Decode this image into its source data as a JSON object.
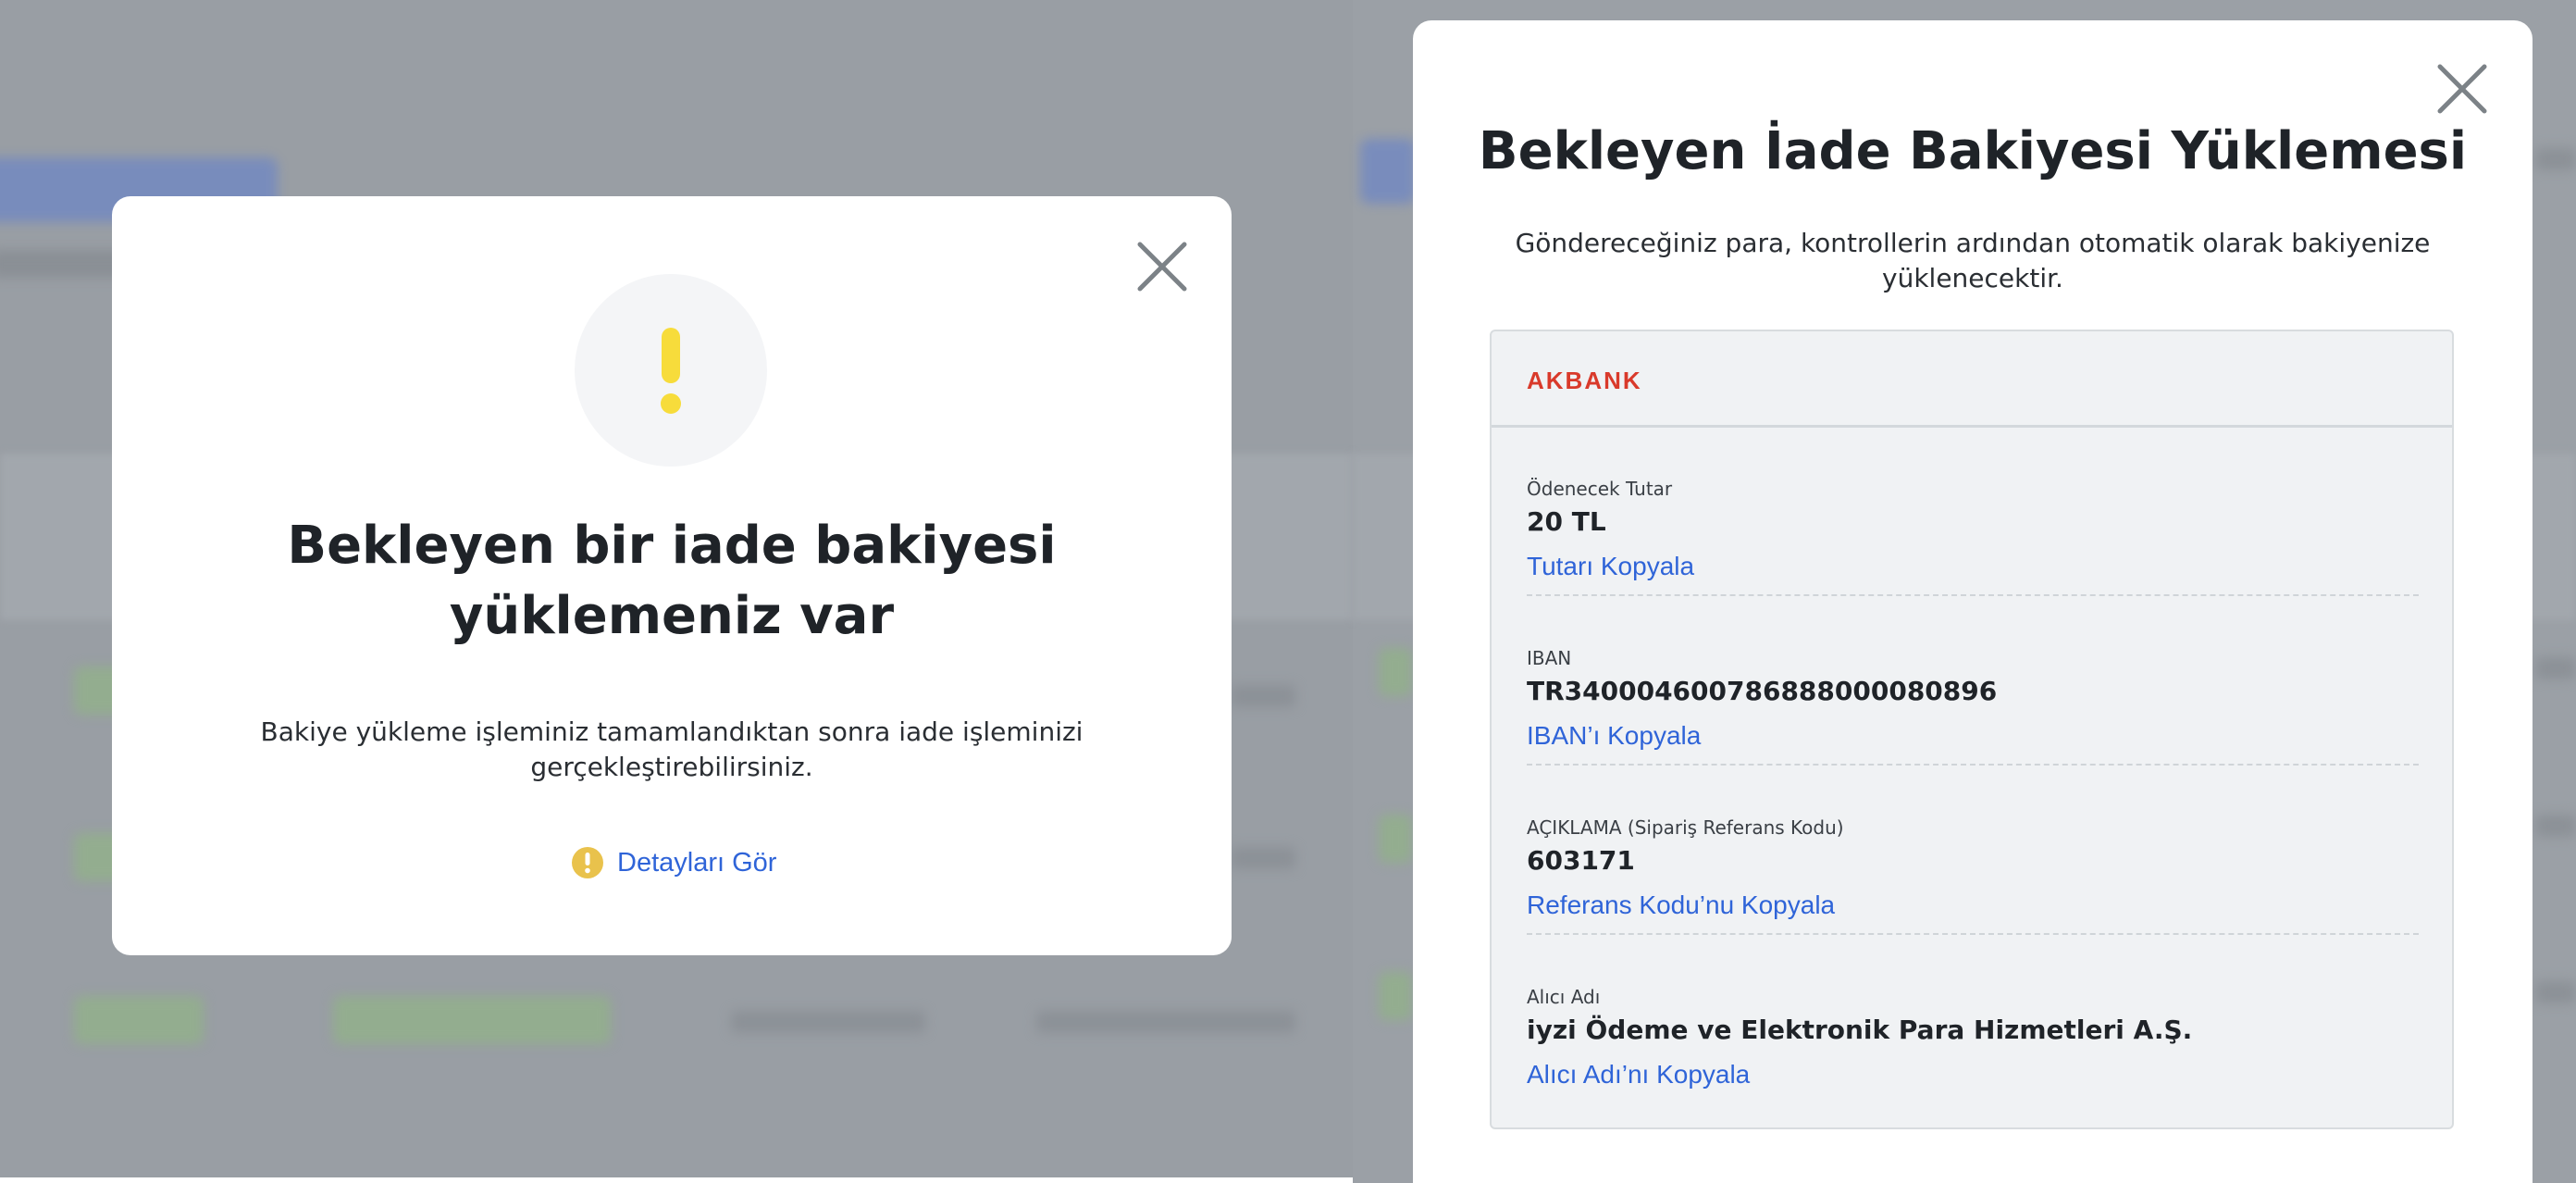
{
  "left_modal": {
    "title_line1": "Bekleyen bir iade bakiyesi",
    "title_line2": "yüklemeniz var",
    "description_line1": "Bakiye yükleme işleminiz tamamlandıktan sonra iade işleminizi",
    "description_line2": "gerçekleştirebilirsiniz.",
    "details_link": "Detayları Gör",
    "warning_icon": "exclamation-icon",
    "close_icon": "close-icon"
  },
  "right_modal": {
    "title": "Bekleyen İade Bakiyesi Yüklemesi",
    "description_line1": "Göndereceğiniz para, kontrollerin ardından otomatik olarak bakiyenize",
    "description_line2": "yüklenecektir.",
    "bank_name": "AKBANK",
    "close_icon": "close-icon",
    "fields": [
      {
        "label": "Ödenecek Tutar",
        "value": "20 TL",
        "copy_label": "Tutarı Kopyala"
      },
      {
        "label": "IBAN",
        "value": "TR340004600786888000080896",
        "copy_label": "IBAN’ı Kopyala"
      },
      {
        "label": "AÇIKLAMA (Sipariş Referans Kodu)",
        "value": "603171",
        "copy_label": "Referans Kodu’nu Kopyala"
      },
      {
        "label": "Alıcı Adı",
        "value": "iyzi Ödeme ve Elektronik Para Hizmetleri A.Ş.",
        "copy_label": "Alıcı Adı’nı Kopyala"
      }
    ]
  },
  "colors": {
    "overlay": "#999ea4",
    "link": "#2f64d8",
    "warning": "#f7dc3b",
    "warning_small": "#e9c24c",
    "bank_brand": "#d93a2b",
    "close_icon": "#7c8287"
  }
}
